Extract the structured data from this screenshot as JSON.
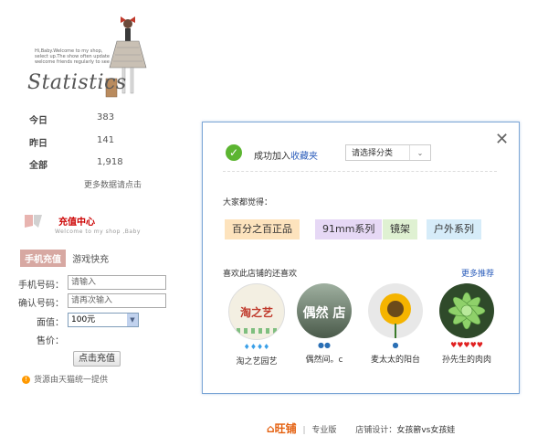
{
  "stats": {
    "tiny_caption": "Hi,Baby.Welcome to my shop, select up.The show often update welcome friends regularly to see",
    "title": "Statistics",
    "rows": [
      {
        "label": "今日",
        "value": "383"
      },
      {
        "label": "昨日",
        "value": "141"
      },
      {
        "label": "全部",
        "value": "1,918"
      }
    ],
    "more_data": "更多数据请点击"
  },
  "recharge": {
    "title": "充值中心",
    "subtitle": "Welcome to my shop ,Baby",
    "tab_active": "手机充值",
    "tab_inactive": "游戏快充",
    "phone_label": "手机号码：",
    "phone_placeholder": "请输入",
    "confirm_label": "确认号码：",
    "confirm_placeholder": "请再次输入",
    "amount_label": "面值：",
    "amount_value": "100元",
    "price_label": "售价：",
    "button": "点击充值",
    "notice": "货源由天猫统一提供"
  },
  "popup": {
    "success_prefix": "成功加入",
    "success_link": "收藏夹",
    "category_select": "请选择分类",
    "everyone_thinks": "大家都觉得：",
    "tags": [
      {
        "label": "百分之百正品",
        "bg": "#fde3bd"
      },
      {
        "label": "91mm系列",
        "bg": "#e6d8f5"
      },
      {
        "label": "镜架",
        "bg": "#dff1d2"
      },
      {
        "label": "户外系列",
        "bg": "#d6ecf9"
      }
    ],
    "also_like": "喜欢此店铺的还喜欢",
    "more_recommend": "更多推荐",
    "shops": [
      {
        "name": "淘之艺园艺",
        "pic_text": "淘之艺",
        "badge": "diamond"
      },
      {
        "name": "偶然间。c",
        "pic_text": "偶然 店",
        "badge": "crown"
      },
      {
        "name": "麦太太的阳台",
        "pic_text": "",
        "badge": "crown"
      },
      {
        "name": "孙先生的肉肉",
        "pic_text": "",
        "badge": "heart"
      }
    ]
  },
  "footer": {
    "logo": "旺铺",
    "edition": "专业版",
    "designer_label": "店铺设计：",
    "designer": "女孩簖vs女孩娃"
  },
  "colors": {
    "link": "#2b5dbb",
    "success": "#5cb531",
    "recharge_title": "#cc0000",
    "tab_active": "#d7a8a2"
  }
}
